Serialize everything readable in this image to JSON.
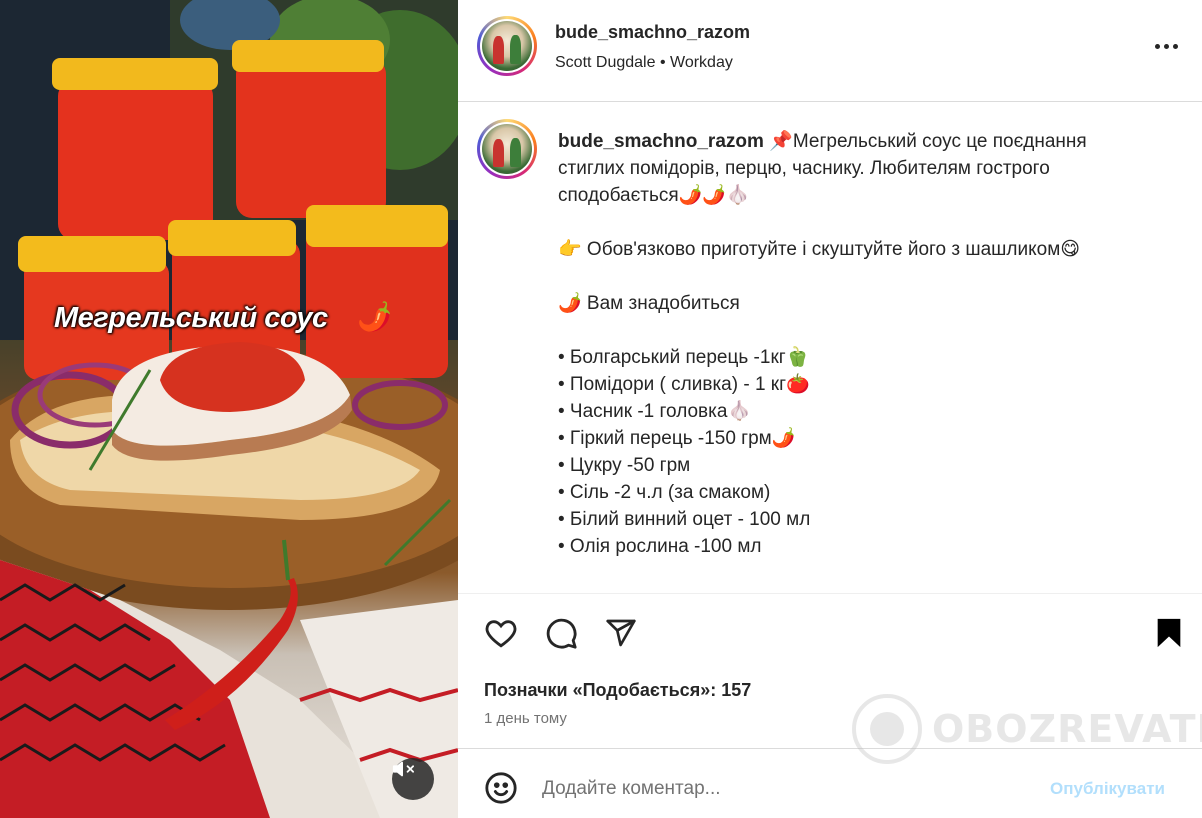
{
  "media": {
    "overlay_title": "Мегрельський соус",
    "overlay_emoji": "🌶️",
    "mute_icon": "speaker-muted-icon"
  },
  "header": {
    "username": "bude_smachno_razom",
    "subline": "Scott Dugdale • Workday",
    "more_icon": "more-horizontal-icon"
  },
  "caption": {
    "username": "bude_smachno_razom",
    "lines": [
      "📌Мегрельський соус це поєднання",
      "стиглих помідорів, перцю, часнику. Любителям гострого",
      "сподобається🌶️🌶️🧄",
      "",
      "👉 Обов'язково приготуйте і скуштуйте його з шашликом😋",
      "",
      "🌶️ Вам знадобиться",
      "",
      "• Болгарський перець -1кг🫑",
      "• Помідори ( сливка) - 1 кг🍅",
      "• Часник -1 головка🧄",
      "• Гіркий перець -150 грм🌶️",
      "• Цукру -50 грм",
      "• Сіль -2 ч.л (за смаком)",
      "• Білий винний оцет - 100 мл",
      "• Олія рослина -100 мл"
    ]
  },
  "actions": {
    "like_icon": "heart-icon",
    "comment_icon": "comment-icon",
    "share_icon": "send-icon",
    "save_icon": "bookmark-icon",
    "likes_text": "Позначки «Подобається»: 157",
    "time_text": "1 день тому"
  },
  "comment": {
    "emoji_icon": "smiley-icon",
    "placeholder": "Додайте коментар...",
    "publish_label": "Опублікувати"
  },
  "watermark": {
    "text": "OBOZREVATEL"
  },
  "colors": {
    "text": "#262626",
    "secondary": "#737373",
    "publish_disabled": "#b2dffc",
    "border": "#dbdbdb"
  }
}
